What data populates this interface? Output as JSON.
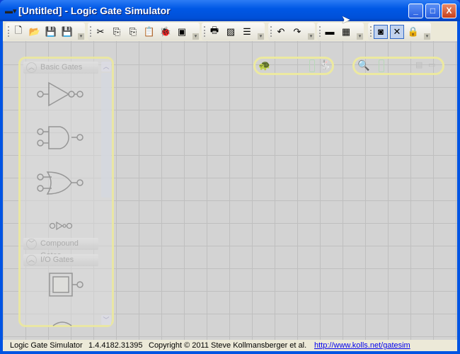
{
  "window": {
    "title": "[Untitled] - Logic Gate Simulator",
    "controls": {
      "minimize": "_",
      "maximize": "□",
      "close": "X"
    }
  },
  "toolbar": {
    "groups": [
      {
        "buttons": [
          {
            "icon": "new-icon",
            "glyph": "🗋"
          },
          {
            "icon": "open-icon",
            "glyph": "📂"
          },
          {
            "icon": "save-icon",
            "glyph": "💾"
          },
          {
            "icon": "save-as-icon",
            "glyph": "💾"
          }
        ]
      },
      {
        "buttons": [
          {
            "icon": "cut-icon",
            "glyph": "✂"
          },
          {
            "icon": "copy-icon",
            "glyph": "⎘"
          },
          {
            "icon": "copy-as-image-icon",
            "glyph": "⎘"
          },
          {
            "icon": "paste-icon",
            "glyph": "📋"
          },
          {
            "icon": "bug-icon",
            "glyph": "🐞"
          },
          {
            "icon": "view-icon",
            "glyph": "▣"
          }
        ]
      },
      {
        "buttons": [
          {
            "icon": "print-icon",
            "glyph": "🖶"
          },
          {
            "icon": "export-image-icon",
            "glyph": "▨"
          },
          {
            "icon": "options-icon",
            "glyph": "☰"
          }
        ]
      },
      {
        "buttons": [
          {
            "icon": "undo-icon",
            "glyph": "↶"
          },
          {
            "icon": "redo-icon",
            "glyph": "↷"
          }
        ]
      },
      {
        "buttons": [
          {
            "icon": "chip-icon",
            "glyph": "▬"
          },
          {
            "icon": "calculator-icon",
            "glyph": "▦"
          }
        ]
      },
      {
        "buttons": [
          {
            "icon": "gate-view-icon",
            "glyph": "◙",
            "active": true
          },
          {
            "icon": "wire-delete-icon",
            "glyph": "✕",
            "active": true
          },
          {
            "icon": "lock-icon",
            "glyph": "🔒"
          }
        ]
      }
    ]
  },
  "palette": {
    "sections": [
      {
        "label": "Basic Gates",
        "expanded": true
      },
      {
        "label": "Compound Gates",
        "expanded": false
      },
      {
        "label": "I/O Gates",
        "expanded": true
      }
    ]
  },
  "speed_control": {
    "slow_icon": "turtle-icon",
    "fast_icon": "rabbit-icon"
  },
  "zoom_control": {
    "icon": "zoom-icon",
    "fit_icon": "zoom-fit-icon",
    "reset_icon": "zoom-reset-icon"
  },
  "status": {
    "app_name": "Logic Gate Simulator",
    "version": "1.4.4182.31395",
    "copyright": "Copyright © 2011 Steve Kollmansberger et al.",
    "link": "http://www.kolls.net/gatesim"
  }
}
